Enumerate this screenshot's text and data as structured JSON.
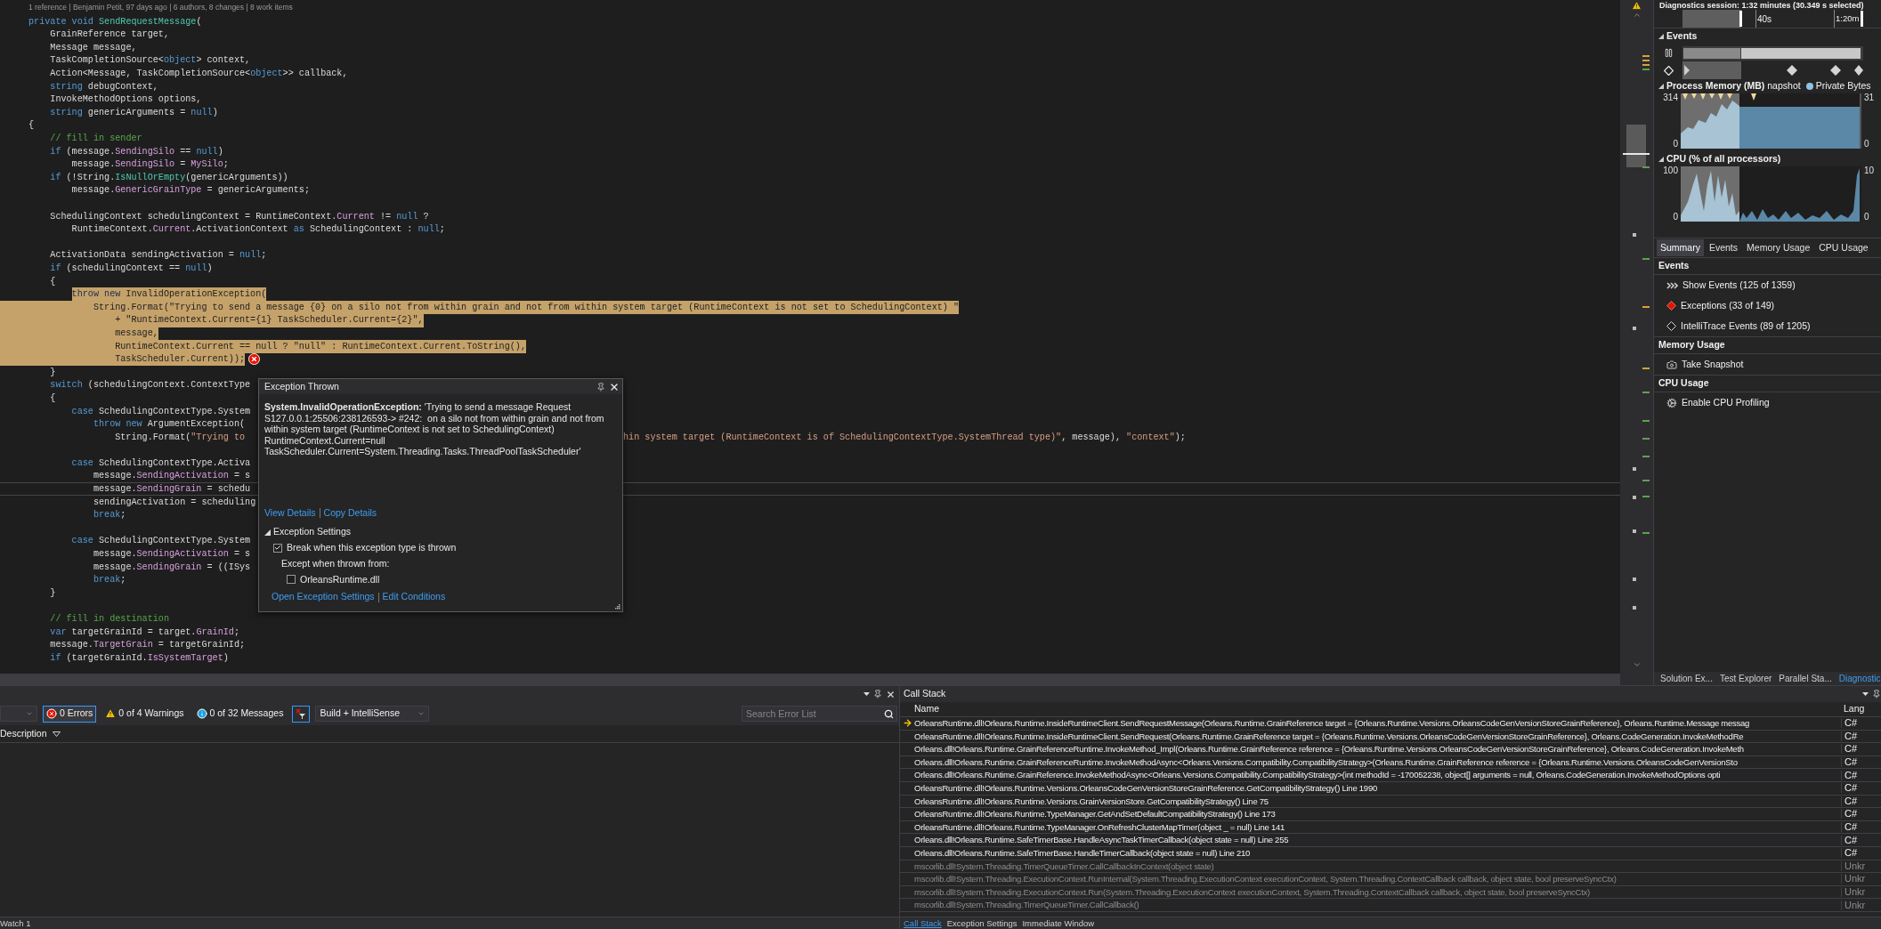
{
  "editor": {
    "codelens": "1 reference | Benjamin Petit, 97 days ago | 6 authors, 8 changes | 8 work items",
    "lines": [
      {
        "highlighted": false,
        "current": false,
        "error": false,
        "tokens": [
          {
            "text": "private void ",
            "kind": "kw"
          },
          {
            "text": "SendRequestMessage",
            "kind": "method"
          },
          {
            "text": "(",
            "kind": "plain"
          }
        ]
      },
      {
        "highlighted": false,
        "current": false,
        "error": false,
        "tokens": [
          {
            "text": "    GrainReference target,",
            "kind": "plain"
          }
        ]
      },
      {
        "highlighted": false,
        "current": false,
        "error": false,
        "tokens": [
          {
            "text": "    Message message,",
            "kind": "plain"
          }
        ]
      },
      {
        "highlighted": false,
        "current": false,
        "error": false,
        "tokens": [
          {
            "text": "    TaskCompletionSource<",
            "kind": "plain"
          },
          {
            "text": "object",
            "kind": "kw"
          },
          {
            "text": "> context,",
            "kind": "plain"
          }
        ]
      },
      {
        "highlighted": false,
        "current": false,
        "error": false,
        "tokens": [
          {
            "text": "    Action<Message, TaskCompletionSource<",
            "kind": "plain"
          },
          {
            "text": "object",
            "kind": "kw"
          },
          {
            "text": ">> callback,",
            "kind": "plain"
          }
        ]
      },
      {
        "highlighted": false,
        "current": false,
        "error": false,
        "tokens": [
          {
            "text": "    string",
            "kind": "kw"
          },
          {
            "text": " debugContext,",
            "kind": "plain"
          }
        ]
      },
      {
        "highlighted": false,
        "current": false,
        "error": false,
        "tokens": [
          {
            "text": "    InvokeMethodOptions options,",
            "kind": "plain"
          }
        ]
      },
      {
        "highlighted": false,
        "current": false,
        "error": false,
        "tokens": [
          {
            "text": "    string",
            "kind": "kw"
          },
          {
            "text": " genericArguments = ",
            "kind": "plain"
          },
          {
            "text": "null",
            "kind": "kw"
          },
          {
            "text": ")",
            "kind": "plain"
          }
        ]
      },
      {
        "highlighted": false,
        "current": false,
        "error": false,
        "tokens": [
          {
            "text": "{",
            "kind": "plain"
          }
        ]
      },
      {
        "highlighted": false,
        "current": false,
        "error": false,
        "tokens": [
          {
            "text": "    // fill in sender",
            "kind": "comment"
          }
        ]
      },
      {
        "highlighted": false,
        "current": false,
        "error": false,
        "tokens": [
          {
            "text": "    if",
            "kind": "kw"
          },
          {
            "text": " (message.",
            "kind": "plain"
          },
          {
            "text": "SendingSilo",
            "kind": "prop"
          },
          {
            "text": " == ",
            "kind": "plain"
          },
          {
            "text": "null",
            "kind": "kw"
          },
          {
            "text": ")",
            "kind": "plain"
          }
        ]
      },
      {
        "highlighted": false,
        "current": false,
        "error": false,
        "tokens": [
          {
            "text": "        message.",
            "kind": "plain"
          },
          {
            "text": "SendingSilo",
            "kind": "prop"
          },
          {
            "text": " = ",
            "kind": "plain"
          },
          {
            "text": "MySilo",
            "kind": "prop"
          },
          {
            "text": ";",
            "kind": "plain"
          }
        ]
      },
      {
        "highlighted": false,
        "current": false,
        "error": false,
        "tokens": [
          {
            "text": "    if",
            "kind": "kw"
          },
          {
            "text": " (!String.",
            "kind": "plain"
          },
          {
            "text": "IsNullOrEmpty",
            "kind": "method"
          },
          {
            "text": "(genericArguments))",
            "kind": "plain"
          }
        ]
      },
      {
        "highlighted": false,
        "current": false,
        "error": false,
        "tokens": [
          {
            "text": "        message.",
            "kind": "plain"
          },
          {
            "text": "GenericGrainType",
            "kind": "prop"
          },
          {
            "text": " = genericArguments;",
            "kind": "plain"
          }
        ]
      },
      {
        "highlighted": false,
        "current": false,
        "error": false
      },
      {
        "highlighted": false,
        "current": false,
        "error": false,
        "tokens": [
          {
            "text": "    SchedulingContext schedulingContext = RuntimeContext.",
            "kind": "plain"
          },
          {
            "text": "Current",
            "kind": "prop"
          },
          {
            "text": " != ",
            "kind": "plain"
          },
          {
            "text": "null",
            "kind": "kw"
          },
          {
            "text": " ?",
            "kind": "plain"
          }
        ]
      },
      {
        "highlighted": false,
        "current": false,
        "error": false,
        "tokens": [
          {
            "text": "        RuntimeContext.",
            "kind": "plain"
          },
          {
            "text": "Current",
            "kind": "prop"
          },
          {
            "text": ".ActivationContext ",
            "kind": "plain"
          },
          {
            "text": "as",
            "kind": "kw"
          },
          {
            "text": " SchedulingContext : ",
            "kind": "plain"
          },
          {
            "text": "null",
            "kind": "kw"
          },
          {
            "text": ";",
            "kind": "plain"
          }
        ]
      },
      {
        "highlighted": false,
        "current": false,
        "error": false
      },
      {
        "highlighted": false,
        "current": false,
        "error": false,
        "tokens": [
          {
            "text": "    ActivationData sendingActivation = ",
            "kind": "plain"
          },
          {
            "text": "null",
            "kind": "kw"
          },
          {
            "text": ";",
            "kind": "plain"
          }
        ]
      },
      {
        "highlighted": false,
        "current": false,
        "error": false,
        "tokens": [
          {
            "text": "    if",
            "kind": "kw"
          },
          {
            "text": " (schedulingContext == ",
            "kind": "plain"
          },
          {
            "text": "null",
            "kind": "kw"
          },
          {
            "text": ")",
            "kind": "plain"
          }
        ]
      },
      {
        "highlighted": false,
        "current": false,
        "error": false,
        "tokens": [
          {
            "text": "    {",
            "kind": "plain"
          }
        ]
      },
      {
        "highlighted": true,
        "current": false,
        "error": false,
        "tokens": [
          {
            "text": "        throw new",
            "kind": "kw"
          },
          {
            "text": " InvalidOperationException(",
            "kind": "plain"
          }
        ]
      },
      {
        "highlighted": true,
        "current": false,
        "error": false,
        "tokens": [
          {
            "text": "            String.Format(\"Trying to send a message {0} on a silo not from within grain and not from within system target (RuntimeContext is not set to SchedulingContext) \"",
            "kind": "plain"
          }
        ]
      },
      {
        "highlighted": true,
        "current": false,
        "error": false,
        "tokens": [
          {
            "text": "                + \"RuntimeContext.Current={1} TaskScheduler.Current={2}\",",
            "kind": "plain"
          }
        ]
      },
      {
        "highlighted": true,
        "current": false,
        "error": false,
        "tokens": [
          {
            "text": "                message,",
            "kind": "plain"
          }
        ]
      },
      {
        "highlighted": true,
        "current": false,
        "error": false,
        "tokens": [
          {
            "text": "                RuntimeContext.Current == null ? \"null\" : RuntimeContext.Current.ToString(),",
            "kind": "plain"
          }
        ]
      },
      {
        "highlighted": true,
        "current": false,
        "error": true,
        "tokens": [
          {
            "text": "                TaskScheduler.Current));",
            "kind": "plain"
          }
        ]
      },
      {
        "highlighted": false,
        "current": false,
        "error": false,
        "tokens": [
          {
            "text": "    }",
            "kind": "plain"
          }
        ]
      },
      {
        "highlighted": false,
        "current": false,
        "error": false,
        "tokens": [
          {
            "text": "    switch",
            "kind": "kw"
          },
          {
            "text": " (schedulingContext.ContextType",
            "kind": "plain"
          }
        ]
      },
      {
        "highlighted": false,
        "current": false,
        "error": false,
        "tokens": [
          {
            "text": "    {",
            "kind": "plain"
          }
        ]
      },
      {
        "highlighted": false,
        "current": false,
        "error": false,
        "tokens": [
          {
            "text": "        case",
            "kind": "kw"
          },
          {
            "text": " SchedulingContextType.System",
            "kind": "plain"
          }
        ]
      },
      {
        "highlighted": false,
        "current": false,
        "error": false,
        "tokens": [
          {
            "text": "            throw new",
            "kind": "kw"
          },
          {
            "text": " ArgumentException(",
            "kind": "plain"
          }
        ]
      },
      {
        "highlighted": false,
        "current": false,
        "error": false,
        "tokens": [
          {
            "text": "                String.Format(",
            "kind": "plain"
          },
          {
            "text": "\"Trying to",
            "kind": "str"
          }
        ],
        "tokens_after_popup": [
          {
            "text": "hin system target (RuntimeContext is of SchedulingContextType.SystemThread type)\"",
            "kind": "str"
          },
          {
            "text": ", message), ",
            "kind": "plain"
          },
          {
            "text": "\"context\"",
            "kind": "str"
          },
          {
            "text": ");",
            "kind": "plain"
          }
        ]
      },
      {
        "highlighted": false,
        "current": false,
        "error": false
      },
      {
        "highlighted": false,
        "current": false,
        "error": false,
        "tokens": [
          {
            "text": "        case",
            "kind": "kw"
          },
          {
            "text": " SchedulingContextType.Activa",
            "kind": "plain"
          }
        ]
      },
      {
        "highlighted": false,
        "current": false,
        "error": false,
        "tokens": [
          {
            "text": "            message.",
            "kind": "plain"
          },
          {
            "text": "SendingActivation",
            "kind": "prop"
          },
          {
            "text": " = s",
            "kind": "plain"
          }
        ]
      },
      {
        "highlighted": false,
        "current": true,
        "error": false,
        "tokens": [
          {
            "text": "            message.",
            "kind": "plain"
          },
          {
            "text": "SendingGrain",
            "kind": "prop"
          },
          {
            "text": " = schedu",
            "kind": "plain"
          }
        ]
      },
      {
        "highlighted": false,
        "current": false,
        "error": false,
        "tokens": [
          {
            "text": "            sendingActivation = scheduling",
            "kind": "plain"
          }
        ]
      },
      {
        "highlighted": false,
        "current": false,
        "error": false,
        "tokens": [
          {
            "text": "            break",
            "kind": "kw"
          },
          {
            "text": ";",
            "kind": "plain"
          }
        ]
      },
      {
        "highlighted": false,
        "current": false,
        "error": false
      },
      {
        "highlighted": false,
        "current": false,
        "error": false,
        "tokens": [
          {
            "text": "        case",
            "kind": "kw"
          },
          {
            "text": " SchedulingContextType.System",
            "kind": "plain"
          }
        ]
      },
      {
        "highlighted": false,
        "current": false,
        "error": false,
        "tokens": [
          {
            "text": "            message.",
            "kind": "plain"
          },
          {
            "text": "SendingActivation",
            "kind": "prop"
          },
          {
            "text": " = s",
            "kind": "plain"
          }
        ]
      },
      {
        "highlighted": false,
        "current": false,
        "error": false,
        "tokens": [
          {
            "text": "            message.",
            "kind": "plain"
          },
          {
            "text": "SendingGrain",
            "kind": "prop"
          },
          {
            "text": " = ((ISys",
            "kind": "plain"
          }
        ]
      },
      {
        "highlighted": false,
        "current": false,
        "error": false,
        "tokens": [
          {
            "text": "            break",
            "kind": "kw"
          },
          {
            "text": ";",
            "kind": "plain"
          }
        ]
      },
      {
        "highlighted": false,
        "current": false,
        "error": false,
        "tokens": [
          {
            "text": "    }",
            "kind": "plain"
          }
        ]
      },
      {
        "highlighted": false,
        "current": false,
        "error": false
      },
      {
        "highlighted": false,
        "current": false,
        "error": false,
        "tokens": [
          {
            "text": "    // fill in destination",
            "kind": "comment"
          }
        ]
      },
      {
        "highlighted": false,
        "current": false,
        "error": false,
        "tokens": [
          {
            "text": "    var",
            "kind": "kw"
          },
          {
            "text": " targetGrainId = target.",
            "kind": "plain"
          },
          {
            "text": "GrainId",
            "kind": "prop"
          },
          {
            "text": ";",
            "kind": "plain"
          }
        ]
      },
      {
        "highlighted": false,
        "current": false,
        "error": false,
        "tokens": [
          {
            "text": "    message.",
            "kind": "plain"
          },
          {
            "text": "TargetGrain",
            "kind": "prop"
          },
          {
            "text": " = targetGrainId;",
            "kind": "plain"
          }
        ]
      },
      {
        "highlighted": false,
        "current": false,
        "error": false,
        "tokens": [
          {
            "text": "    if",
            "kind": "kw"
          },
          {
            "text": " (targetGrainId.",
            "kind": "plain"
          },
          {
            "text": "IsSystemTarget",
            "kind": "prop"
          },
          {
            "text": ")",
            "kind": "plain"
          }
        ]
      }
    ]
  },
  "exception_popup": {
    "title": "Exception Thrown",
    "message": "**System.InvalidOperationException:** 'Trying to send a message Request S127.0.0.1:25506:238126593-> #242:  on a silo not from within grain and not from within system target (RuntimeContext is not set to SchedulingContext)\nRuntimeContext.Current=null\nTaskScheduler.Current=System.Threading.Tasks.ThreadPoolTaskScheduler'",
    "links": [
      "View Details",
      "Copy Details"
    ],
    "settings": {
      "label": "Exception Settings",
      "expanded": true,
      "break_option": {
        "label": "Break when this exception type is thrown",
        "checked": true
      },
      "except_label": "Except when thrown from:",
      "modules": [
        {
          "label": "OrleansRuntime.dll",
          "checked": false
        }
      ]
    },
    "footer_links": [
      "Open Exception Settings",
      "Edit Conditions"
    ]
  },
  "diagnostics": {
    "session": "Diagnostics session: 1:32 minutes (30.349 s selected)",
    "ruler": [
      "40s",
      "1:20m"
    ],
    "events_title": "Events",
    "memory": {
      "title": "Process Memory (MB)",
      "snapshot_legend": "napshot",
      "bytes_legend": "Private Bytes",
      "left_ticks": [
        "314",
        "0"
      ],
      "right_ticks": [
        "31",
        "0"
      ]
    },
    "cpu": {
      "title": "CPU (% of all processors)",
      "left_ticks": [
        "100",
        "0"
      ],
      "right_ticks": [
        "10",
        "0"
      ]
    },
    "tabs": [
      {
        "label": "Summary",
        "selected": true
      },
      {
        "label": "Events",
        "selected": false
      },
      {
        "label": "Memory Usage",
        "selected": false
      },
      {
        "label": "CPU Usage",
        "selected": false
      }
    ],
    "sections": [
      {
        "title": "Events",
        "items": [
          {
            "label": "Show Events (125 of 1359)",
            "kind": "events"
          },
          {
            "label": "Exceptions (33 of 149)",
            "kind": "exception"
          },
          {
            "label": "IntelliTrace Events (89 of 1205)",
            "kind": "intellitrace"
          }
        ]
      },
      {
        "title": "Memory Usage",
        "items": [
          {
            "label": "Take Snapshot",
            "kind": "snapshot"
          }
        ]
      },
      {
        "title": "CPU Usage",
        "items": [
          {
            "label": "Enable CPU Profiling",
            "kind": "profiling"
          }
        ]
      }
    ],
    "bottom_tabs": [
      {
        "label": "Solution Ex...",
        "selected": false
      },
      {
        "label": "Test Explorer",
        "selected": false
      },
      {
        "label": "Parallel Sta...",
        "selected": false
      },
      {
        "label": "Diagnostic",
        "selected": true
      }
    ]
  },
  "error_list": {
    "filters": [
      {
        "label": "0 Errors",
        "kind": "error",
        "selected": true
      },
      {
        "label": "0 of 4 Warnings",
        "kind": "warning",
        "selected": false
      },
      {
        "label": "0 of 32 Messages",
        "kind": "message",
        "selected": false
      }
    ],
    "source": "Build + IntelliSense",
    "search": {
      "placeholder": "Search Error List"
    },
    "column": "Description",
    "tab": "Watch 1"
  },
  "call_stack": {
    "title": "Call Stack",
    "columns": [
      "Name",
      "Lang"
    ],
    "rows": [
      {
        "name": "OrleansRuntime.dll!Orleans.Runtime.InsideRuntimeClient.SendRequestMessage(Orleans.Runtime.GrainReference target = {Orleans.Runtime.Versions.OrleansCodeGenVersionStoreGrainReference}, Orleans.Runtime.Message messag",
        "lang": "C#",
        "current": true,
        "external": false
      },
      {
        "name": "OrleansRuntime.dll!Orleans.Runtime.InsideRuntimeClient.SendRequest(Orleans.Runtime.GrainReference target = {Orleans.Runtime.Versions.OrleansCodeGenVersionStoreGrainReference}, Orleans.CodeGeneration.InvokeMethodRe",
        "lang": "C#",
        "current": false,
        "external": false
      },
      {
        "name": "Orleans.dll!Orleans.Runtime.GrainReferenceRuntime.InvokeMethod_Impl(Orleans.Runtime.GrainReference reference = {Orleans.Runtime.Versions.OrleansCodeGenVersionStoreGrainReference}, Orleans.CodeGeneration.InvokeMeth",
        "lang": "C#",
        "current": false,
        "external": false
      },
      {
        "name": "Orleans.dll!Orleans.Runtime.GrainReferenceRuntime.InvokeMethodAsync<Orleans.Versions.Compatibility.CompatibilityStrategy>(Orleans.Runtime.GrainReference reference = {Orleans.Runtime.Versions.OrleansCodeGenVersionSto",
        "lang": "C#",
        "current": false,
        "external": false
      },
      {
        "name": "Orleans.dll!Orleans.Runtime.GrainReference.InvokeMethodAsync<Orleans.Versions.Compatibility.CompatibilityStrategy>(int methodId = -170052238, object[] arguments = null, Orleans.CodeGeneration.InvokeMethodOptions opti",
        "lang": "C#",
        "current": false,
        "external": false
      },
      {
        "name": "OrleansRuntime.dll!Orleans.Runtime.Versions.OrleansCodeGenVersionStoreGrainReference.GetCompatibilityStrategy() Line 1990",
        "lang": "C#",
        "current": false,
        "external": false
      },
      {
        "name": "OrleansRuntime.dll!Orleans.Runtime.Versions.GrainVersionStore.GetCompatibilityStrategy() Line 75",
        "lang": "C#",
        "current": false,
        "external": false
      },
      {
        "name": "OrleansRuntime.dll!Orleans.Runtime.TypeManager.GetAndSetDefaultCompatibilityStrategy() Line 173",
        "lang": "C#",
        "current": false,
        "external": false
      },
      {
        "name": "OrleansRuntime.dll!Orleans.Runtime.TypeManager.OnRefreshClusterMapTimer(object _ = null) Line 141",
        "lang": "C#",
        "current": false,
        "external": false
      },
      {
        "name": "Orleans.dll!Orleans.Runtime.SafeTimerBase.HandleAsyncTaskTimerCallback(object state = null) Line 255",
        "lang": "C#",
        "current": false,
        "external": false
      },
      {
        "name": "Orleans.dll!Orleans.Runtime.SafeTimerBase.HandleTimerCallback(object state = null) Line 210",
        "lang": "C#",
        "current": false,
        "external": false
      },
      {
        "name": "mscorlib.dll!System.Threading.TimerQueueTimer.CallCallbackInContext(object state)",
        "lang": "Unkr",
        "current": false,
        "external": true
      },
      {
        "name": "mscorlib.dll!System.Threading.ExecutionContext.RunInternal(System.Threading.ExecutionContext executionContext, System.Threading.ContextCallback callback, object state, bool preserveSyncCtx)",
        "lang": "Unkr",
        "current": false,
        "external": true
      },
      {
        "name": "mscorlib.dll!System.Threading.ExecutionContext.Run(System.Threading.ExecutionContext executionContext, System.Threading.ContextCallback callback, object state, bool preserveSyncCtx)",
        "lang": "Unkr",
        "current": false,
        "external": true
      },
      {
        "name": "mscorlib.dll!System.Threading.TimerQueueTimer.CallCallback()",
        "lang": "Unkr",
        "current": false,
        "external": true
      }
    ],
    "tabs": [
      {
        "label": "Call Stack",
        "selected": true
      },
      {
        "label": "Exception Settings",
        "selected": false
      },
      {
        "label": "Immediate Window",
        "selected": false
      }
    ]
  }
}
